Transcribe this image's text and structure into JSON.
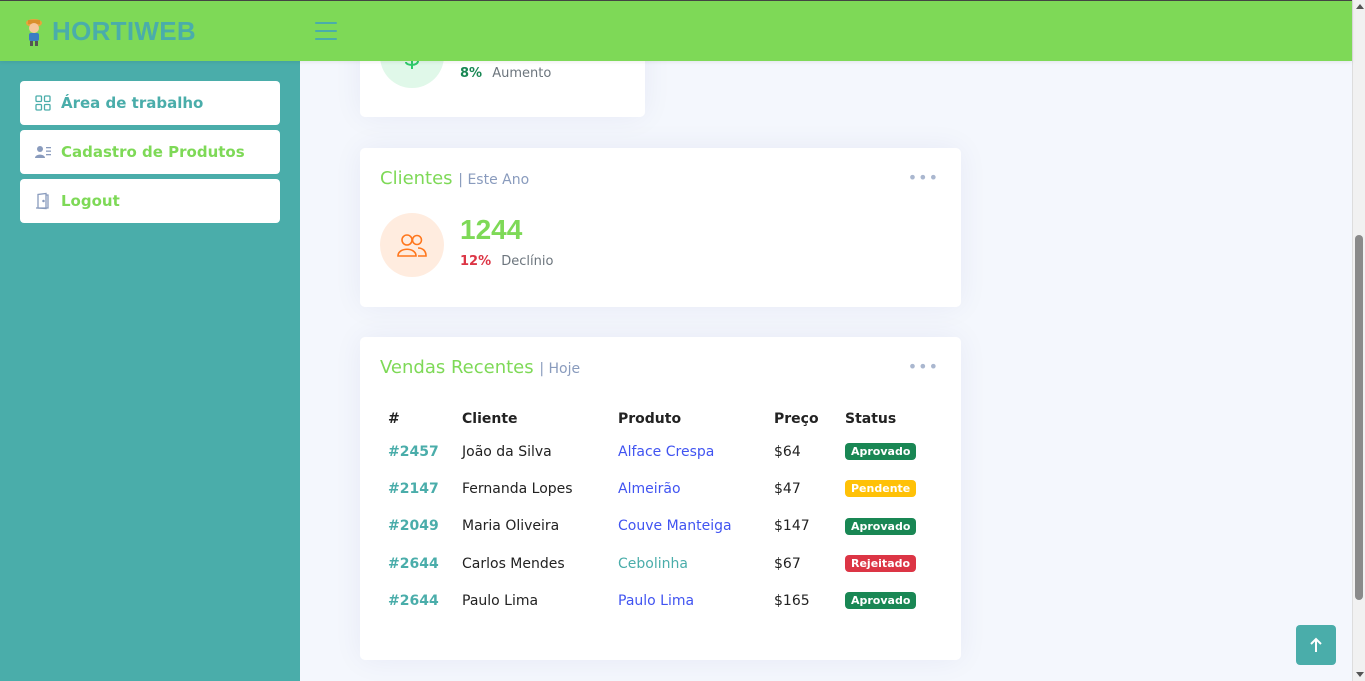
{
  "brand": {
    "name": "HORTIWEB"
  },
  "sidebar": {
    "items": [
      {
        "label": "Área de trabalho",
        "icon": "grid-icon"
      },
      {
        "label": "Cadastro de Produtos",
        "icon": "person-lines-icon"
      },
      {
        "label": "Logout",
        "icon": "door-icon"
      }
    ]
  },
  "revenue_card": {
    "icon": "dollar-icon",
    "pct": "8%",
    "pct_note": "Aumento"
  },
  "clients_card": {
    "title": "Clientes",
    "subtitle": "| Este Ano",
    "value": "1244",
    "pct": "12%",
    "pct_note": "Declínio"
  },
  "sales_card": {
    "title": "Vendas Recentes",
    "subtitle": "| Hoje",
    "columns": [
      "#",
      "Cliente",
      "Produto",
      "Preço",
      "Status"
    ],
    "rows": [
      {
        "id": "#2457",
        "client": "João da Silva",
        "product": "Alface Crespa",
        "price": "$64",
        "status": "Aprovado"
      },
      {
        "id": "#2147",
        "client": "Fernanda Lopes",
        "product": "Almeirão",
        "price": "$47",
        "status": "Pendente"
      },
      {
        "id": "#2049",
        "client": "Maria Oliveira",
        "product": "Couve Manteiga",
        "price": "$147",
        "status": "Aprovado"
      },
      {
        "id": "#2644",
        "client": "Carlos Mendes",
        "product": "Cebolinha",
        "price": "$67",
        "status": "Rejeitado"
      },
      {
        "id": "#2644",
        "client": "Paulo Lima",
        "product": "Paulo Lima",
        "price": "$165",
        "status": "Aprovado"
      }
    ]
  },
  "colors": {
    "header": "#7ed957",
    "sidebar": "#4aadaa",
    "approved": "#198754",
    "pending": "#ffc107",
    "rejected": "#dc3545"
  }
}
